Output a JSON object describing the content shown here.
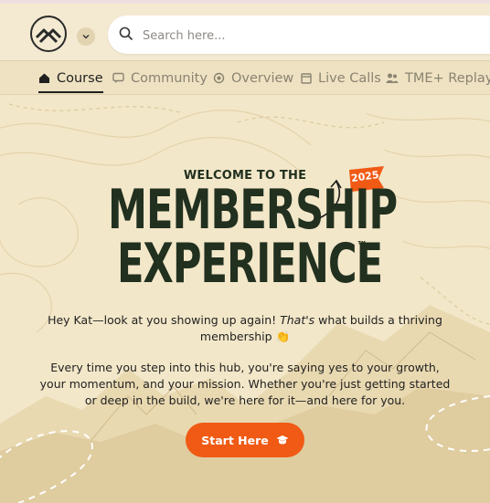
{
  "header": {
    "search": {
      "placeholder": "Search here..."
    }
  },
  "tabs": [
    {
      "label": "Course",
      "icon": "home-icon",
      "active": true
    },
    {
      "label": "Community",
      "icon": "chat-icon",
      "active": false
    },
    {
      "label": "Overview",
      "icon": "target-icon",
      "active": false
    },
    {
      "label": "Live Calls",
      "icon": "calendar-icon",
      "active": false
    },
    {
      "label": "TME+ Replays",
      "icon": "people-icon",
      "active": false
    }
  ],
  "hero": {
    "welcome": "WELCOME TO THE",
    "title_line1": "MEMBERSHIP",
    "title_line2": "EXPERIENCE",
    "trademark": "™",
    "year": "2025",
    "greeting_start": "Hey Kat—look at you showing up again! ",
    "greeting_em": "That's",
    "greeting_end": " what builds a thriving membership 👏",
    "body": "Every time you step into this hub, you're saying yes to your growth, your momentum, and your mission. Whether you're just getting started or deep in the build, we're here for it—and here for you.",
    "cta_label": "Start Here"
  },
  "colors": {
    "accent": "#f05a14",
    "title": "#21301f",
    "background": "#f3e7c9"
  }
}
